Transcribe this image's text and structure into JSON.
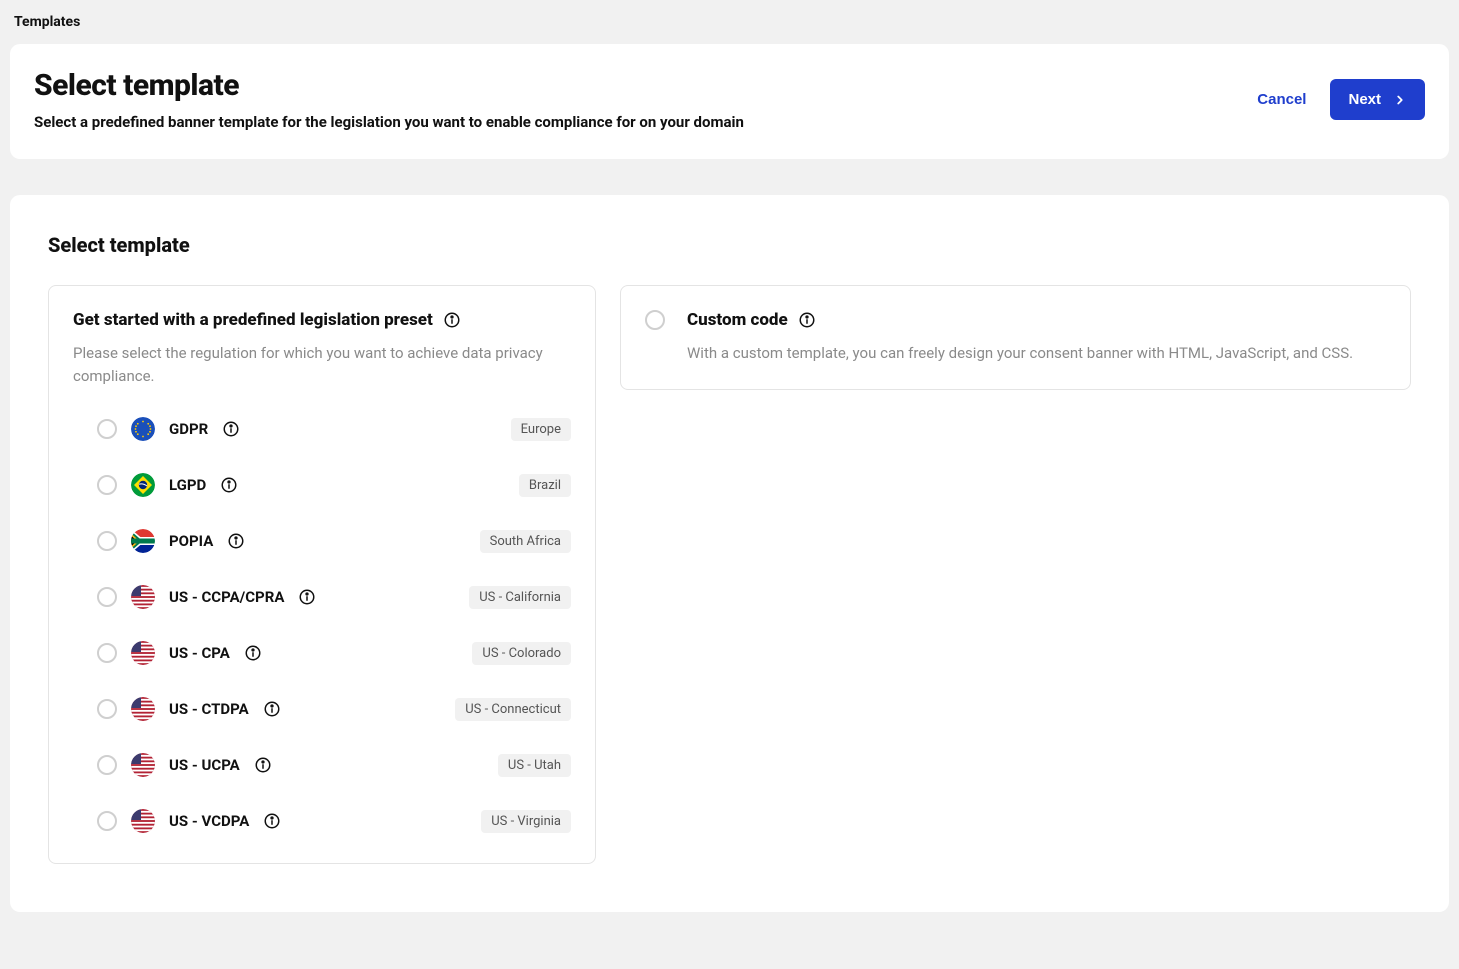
{
  "breadcrumb": "Templates",
  "header": {
    "title": "Select template",
    "subtitle": "Select a predefined banner template for the legislation you want to enable compliance for on your domain",
    "cancel_label": "Cancel",
    "next_label": "Next"
  },
  "section_title": "Select template",
  "preset_panel": {
    "title": "Get started with a predefined legislation preset",
    "description": "Please select the regulation for which you want to achieve data privacy compliance.",
    "items": [
      {
        "name": "GDPR",
        "region": "Europe",
        "flag": "eu"
      },
      {
        "name": "LGPD",
        "region": "Brazil",
        "flag": "br"
      },
      {
        "name": "POPIA",
        "region": "South Africa",
        "flag": "za"
      },
      {
        "name": "US - CCPA/CPRA",
        "region": "US - California",
        "flag": "us"
      },
      {
        "name": "US - CPA",
        "region": "US - Colorado",
        "flag": "us"
      },
      {
        "name": "US - CTDPA",
        "region": "US - Connecticut",
        "flag": "us"
      },
      {
        "name": "US - UCPA",
        "region": "US - Utah",
        "flag": "us"
      },
      {
        "name": "US - VCDPA",
        "region": "US - Virginia",
        "flag": "us"
      }
    ]
  },
  "custom_panel": {
    "title": "Custom code",
    "description": "With a custom template, you can freely design your consent banner with HTML, JavaScript, and CSS."
  },
  "icons": {
    "info": "info-icon",
    "chevron_right": "chevron-right-icon"
  },
  "colors": {
    "primary": "#1f3ecd",
    "background": "#f1f1f1",
    "border": "#e4e4e4",
    "muted_text": "#8a8a8a"
  }
}
